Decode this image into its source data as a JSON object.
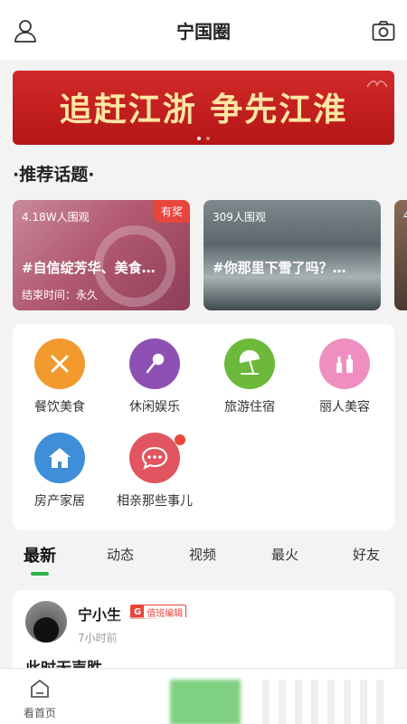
{
  "header": {
    "title": "宁国圈",
    "left_icon": "user-icon",
    "right_icon": "camera-icon"
  },
  "banner": {
    "text": "追赶江浙  争先江淮",
    "colors": {
      "bg": "#c21f1f",
      "text": "#ffe7a3"
    },
    "pages": 2,
    "active_page": 1
  },
  "recommended": {
    "heading": "·推荐话题·",
    "topics": [
      {
        "views": "4.18W人围观",
        "name": "#自信绽芳华、美食…",
        "end_time": "结束时间：永久",
        "badge": "有奖"
      },
      {
        "views": "309人围观",
        "name": "#你那里下雪了吗？…"
      },
      {
        "views": "4",
        "name": ""
      }
    ]
  },
  "categories": [
    {
      "label": "餐饮美食",
      "icon": "fork-knife-icon",
      "color": "#f29a2e"
    },
    {
      "label": "休闲娱乐",
      "icon": "microphone-icon",
      "color": "#8e50b3"
    },
    {
      "label": "旅游住宿",
      "icon": "beach-umbrella-icon",
      "color": "#6cb93b"
    },
    {
      "label": "丽人美容",
      "icon": "cosmetics-icon",
      "color": "#ef8fc0"
    },
    {
      "label": "房产家居",
      "icon": "house-icon",
      "color": "#3e8ed8"
    },
    {
      "label": "相亲那些事儿",
      "icon": "chat-bubble-icon",
      "color": "#e0555f"
    }
  ],
  "feed_tabs": [
    {
      "label": "最新",
      "active": true
    },
    {
      "label": "动态"
    },
    {
      "label": "视频"
    },
    {
      "label": "最火"
    },
    {
      "label": "好友"
    }
  ],
  "post": {
    "username": "宁小生",
    "role_badge": {
      "prefix": "G",
      "text": "值班编辑"
    },
    "time": "7小时前",
    "text": "此时无声胜"
  },
  "bottom_nav": {
    "home_label": "看首页",
    "home_icon": "home-icon"
  },
  "colors": {
    "accent": "#2fb24a",
    "badge_red": "#e8453c"
  }
}
